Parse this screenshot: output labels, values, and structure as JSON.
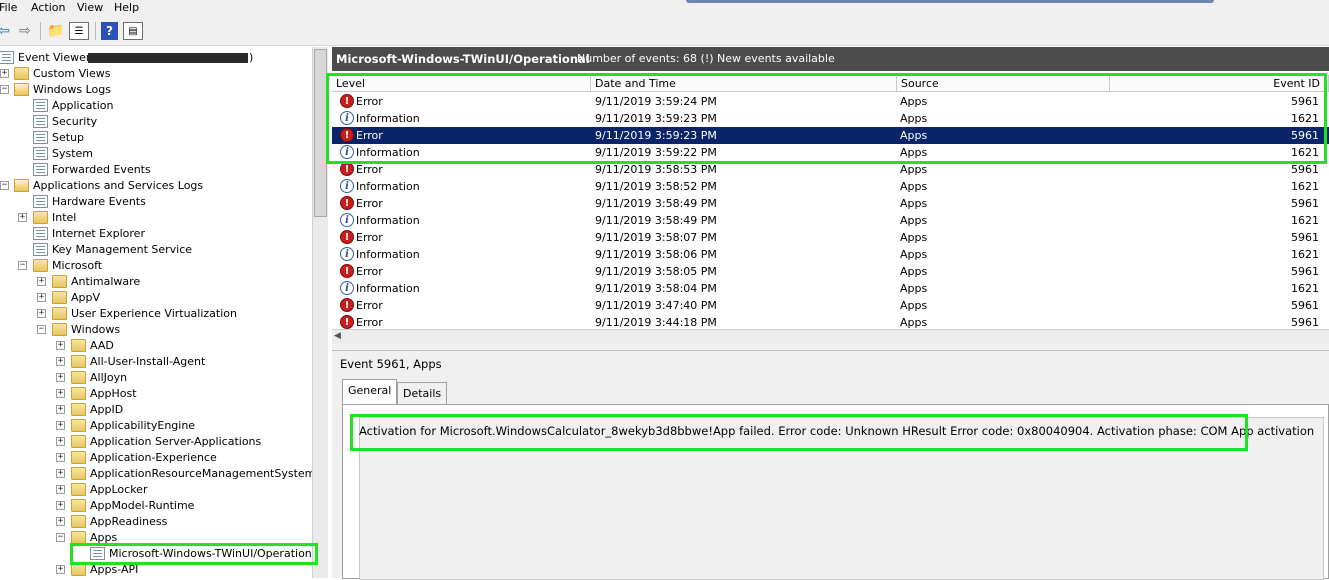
{
  "menu": [
    "File",
    "Action",
    "View",
    "Help"
  ],
  "toolbar": {
    "icons": [
      "back-arrow",
      "forward-arrow",
      "up-folder",
      "show-hide-tree",
      "help",
      "properties"
    ]
  },
  "tree": {
    "items": [
      {
        "label": "Event Viewer (",
        "icon": "event-viewer",
        "expander": "",
        "depth": 0
      },
      {
        "label": "Custom Views",
        "icon": "folder",
        "expander": "+",
        "depth": 1
      },
      {
        "label": "Windows Logs",
        "icon": "folder-open",
        "expander": "−",
        "depth": 1
      },
      {
        "label": "Application",
        "icon": "log",
        "expander": "",
        "depth": 2
      },
      {
        "label": "Security",
        "icon": "log",
        "expander": "",
        "depth": 2
      },
      {
        "label": "Setup",
        "icon": "log",
        "expander": "",
        "depth": 2
      },
      {
        "label": "System",
        "icon": "log",
        "expander": "",
        "depth": 2
      },
      {
        "label": "Forwarded Events",
        "icon": "log",
        "expander": "",
        "depth": 2
      },
      {
        "label": "Applications and Services Logs",
        "icon": "folder-open",
        "expander": "−",
        "depth": 1
      },
      {
        "label": "Hardware Events",
        "icon": "log",
        "expander": "",
        "depth": 2
      },
      {
        "label": "Intel",
        "icon": "folder",
        "expander": "+",
        "depth": 2
      },
      {
        "label": "Internet Explorer",
        "icon": "log",
        "expander": "",
        "depth": 2
      },
      {
        "label": "Key Management Service",
        "icon": "log",
        "expander": "",
        "depth": 2
      },
      {
        "label": "Microsoft",
        "icon": "folder",
        "expander": "−",
        "depth": 2
      },
      {
        "label": "Antimalware",
        "icon": "folder",
        "expander": "+",
        "depth": 3
      },
      {
        "label": "AppV",
        "icon": "folder",
        "expander": "+",
        "depth": 3
      },
      {
        "label": "User Experience Virtualization",
        "icon": "folder",
        "expander": "+",
        "depth": 3
      },
      {
        "label": "Windows",
        "icon": "folder",
        "expander": "−",
        "depth": 3
      },
      {
        "label": "AAD",
        "icon": "folder",
        "expander": "+",
        "depth": 4
      },
      {
        "label": "All-User-Install-Agent",
        "icon": "folder",
        "expander": "+",
        "depth": 4
      },
      {
        "label": "AllJoyn",
        "icon": "folder",
        "expander": "+",
        "depth": 4
      },
      {
        "label": "AppHost",
        "icon": "folder",
        "expander": "+",
        "depth": 4
      },
      {
        "label": "AppID",
        "icon": "folder",
        "expander": "+",
        "depth": 4
      },
      {
        "label": "ApplicabilityEngine",
        "icon": "folder",
        "expander": "+",
        "depth": 4
      },
      {
        "label": "Application Server-Applications",
        "icon": "folder",
        "expander": "+",
        "depth": 4
      },
      {
        "label": "Application-Experience",
        "icon": "folder",
        "expander": "+",
        "depth": 4
      },
      {
        "label": "ApplicationResourceManagementSystem",
        "icon": "folder",
        "expander": "+",
        "depth": 4
      },
      {
        "label": "AppLocker",
        "icon": "folder",
        "expander": "+",
        "depth": 4
      },
      {
        "label": "AppModel-Runtime",
        "icon": "folder",
        "expander": "+",
        "depth": 4
      },
      {
        "label": "AppReadiness",
        "icon": "folder",
        "expander": "+",
        "depth": 4
      },
      {
        "label": "Apps",
        "icon": "folder",
        "expander": "−",
        "depth": 4
      },
      {
        "label": "Microsoft-Windows-TWinUI/Operational",
        "icon": "log",
        "expander": "",
        "depth": 5
      },
      {
        "label": "Apps-API",
        "icon": "folder",
        "expander": "+",
        "depth": 4
      }
    ]
  },
  "header": {
    "log_name": "Microsoft-Windows-TWinUI/Operational",
    "count": "Number of events: 68 (!) New events available"
  },
  "columns": [
    "Level",
    "Date and Time",
    "Source",
    "Event ID"
  ],
  "events": [
    {
      "level": "Error",
      "time": "9/11/2019 3:59:24 PM",
      "source": "Apps",
      "id": "5961"
    },
    {
      "level": "Information",
      "time": "9/11/2019 3:59:23 PM",
      "source": "Apps",
      "id": "1621"
    },
    {
      "level": "Error",
      "time": "9/11/2019 3:59:23 PM",
      "source": "Apps",
      "id": "5961"
    },
    {
      "level": "Information",
      "time": "9/11/2019 3:59:22 PM",
      "source": "Apps",
      "id": "1621"
    },
    {
      "level": "Error",
      "time": "9/11/2019 3:58:53 PM",
      "source": "Apps",
      "id": "5961"
    },
    {
      "level": "Information",
      "time": "9/11/2019 3:58:52 PM",
      "source": "Apps",
      "id": "1621"
    },
    {
      "level": "Error",
      "time": "9/11/2019 3:58:49 PM",
      "source": "Apps",
      "id": "5961"
    },
    {
      "level": "Information",
      "time": "9/11/2019 3:58:49 PM",
      "source": "Apps",
      "id": "1621"
    },
    {
      "level": "Error",
      "time": "9/11/2019 3:58:07 PM",
      "source": "Apps",
      "id": "5961"
    },
    {
      "level": "Information",
      "time": "9/11/2019 3:58:06 PM",
      "source": "Apps",
      "id": "1621"
    },
    {
      "level": "Error",
      "time": "9/11/2019 3:58:05 PM",
      "source": "Apps",
      "id": "5961"
    },
    {
      "level": "Information",
      "time": "9/11/2019 3:58:04 PM",
      "source": "Apps",
      "id": "1621"
    },
    {
      "level": "Error",
      "time": "9/11/2019 3:47:40 PM",
      "source": "Apps",
      "id": "5961"
    },
    {
      "level": "Error",
      "time": "9/11/2019 3:44:18 PM",
      "source": "Apps",
      "id": "5961"
    }
  ],
  "selected_event_index": 2,
  "detail": {
    "title": "Event 5961, Apps",
    "tabs": [
      "General",
      "Details"
    ],
    "active_tab": "General",
    "message": "Activation for Microsoft.WindowsCalculator_8wekyb3d8bbwe!App failed. Error code: Unknown HResult Error code: 0x80040904. Activation phase: COM App activation"
  },
  "colors": {
    "highlight": "#22e022",
    "selection": "#0a246a",
    "header_bar": "#4b4b4b"
  }
}
